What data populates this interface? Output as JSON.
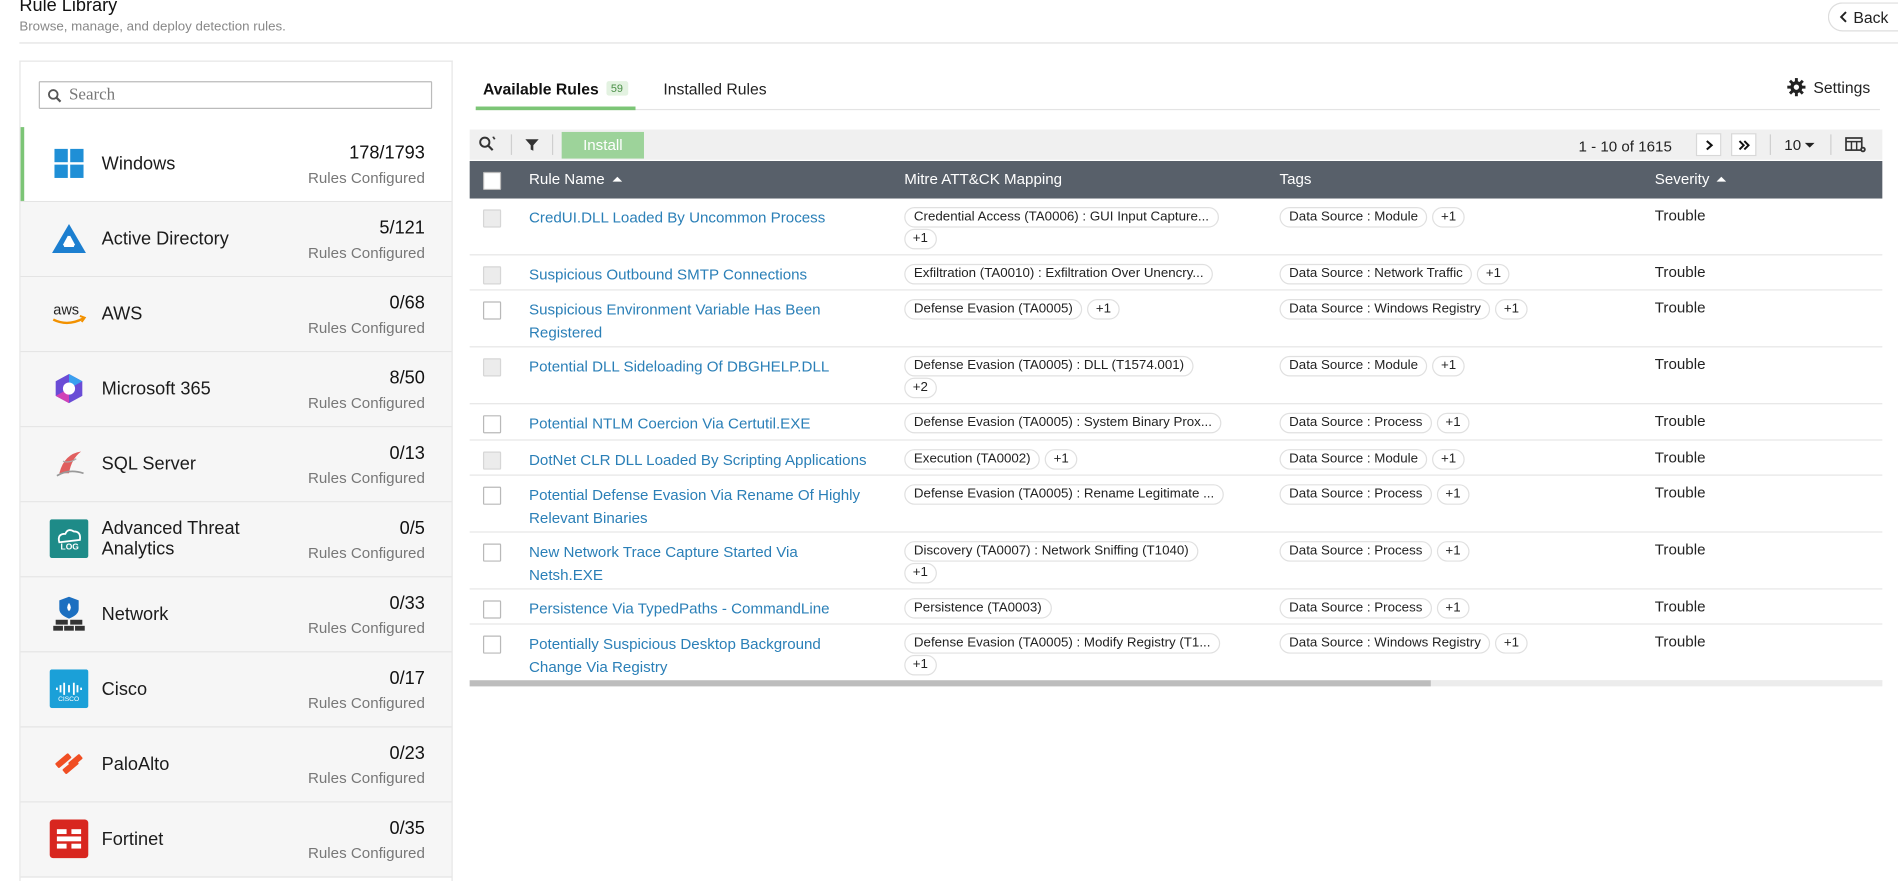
{
  "header": {
    "title": "Rule Library",
    "subtitle": "Browse, manage, and deploy detection rules.",
    "back_label": "Back"
  },
  "sidebar": {
    "search_placeholder": "Search",
    "categories": [
      {
        "name": "Windows",
        "count": "178/1793",
        "sub": "Rules Configured",
        "icon": "windows-icon",
        "active": true
      },
      {
        "name": "Active Directory",
        "count": "5/121",
        "sub": "Rules Configured",
        "icon": "active-directory-icon"
      },
      {
        "name": "AWS",
        "count": "0/68",
        "sub": "Rules Configured",
        "icon": "aws-icon"
      },
      {
        "name": "Microsoft 365",
        "count": "8/50",
        "sub": "Rules Configured",
        "icon": "microsoft-365-icon"
      },
      {
        "name": "SQL Server",
        "count": "0/13",
        "sub": "Rules Configured",
        "icon": "sql-server-icon"
      },
      {
        "name": "Advanced Threat Analytics",
        "count": "0/5",
        "sub": "Rules Configured",
        "icon": "ata-log-icon"
      },
      {
        "name": "Network",
        "count": "0/33",
        "sub": "Rules Configured",
        "icon": "network-firewall-icon"
      },
      {
        "name": "Cisco",
        "count": "0/17",
        "sub": "Rules Configured",
        "icon": "cisco-icon"
      },
      {
        "name": "PaloAlto",
        "count": "0/23",
        "sub": "Rules Configured",
        "icon": "paloalto-icon"
      },
      {
        "name": "Fortinet",
        "count": "0/35",
        "sub": "Rules Configured",
        "icon": "fortinet-icon"
      }
    ]
  },
  "tabs": {
    "available_label": "Available Rules",
    "available_count": "59",
    "installed_label": "Installed Rules",
    "settings_label": "Settings"
  },
  "toolbar": {
    "install_label": "Install",
    "pager_text": "1 - 10 of 1615",
    "per_page": "10"
  },
  "table": {
    "headers": {
      "name": "Rule Name",
      "mitre": "Mitre ATT&CK Mapping",
      "tags": "Tags",
      "severity": "Severity"
    },
    "rows": [
      {
        "name_lines": [
          "CredUI.DLL Loaded By Uncommon Process"
        ],
        "mitre": [
          "Credential Access (TA0006) : GUI Input Capture..."
        ],
        "mitre_plus": "+1",
        "mitre_plus_newline": true,
        "tag": "Data Source : Module",
        "tag_plus": "+1",
        "severity": "Trouble",
        "disabled": true,
        "height": 46
      },
      {
        "name_lines": [
          "Suspicious Outbound SMTP Connections"
        ],
        "mitre": [
          "Exfiltration (TA0010) : Exfiltration Over Unencry..."
        ],
        "mitre_plus": "",
        "mitre_plus_newline": false,
        "tag": "Data Source : Network Traffic",
        "tag_plus": "+1",
        "severity": "Trouble",
        "disabled": true,
        "height": 28
      },
      {
        "name_lines": [
          "Suspicious Environment Variable Has Been",
          "Registered"
        ],
        "mitre": [
          "Defense Evasion (TA0005)"
        ],
        "mitre_plus": "+1",
        "mitre_plus_newline": false,
        "tag": "Data Source : Windows Registry",
        "tag_plus": "+1",
        "severity": "Trouble",
        "disabled": false,
        "height": 46
      },
      {
        "name_lines": [
          "Potential DLL Sideloading Of DBGHELP.DLL"
        ],
        "mitre": [
          "Defense Evasion (TA0005) : DLL (T1574.001)"
        ],
        "mitre_plus": "+2",
        "mitre_plus_newline": true,
        "tag": "Data Source : Module",
        "tag_plus": "+1",
        "severity": "Trouble",
        "disabled": true,
        "height": 46
      },
      {
        "name_lines": [
          "Potential NTLM Coercion Via Certutil.EXE"
        ],
        "mitre": [
          "Defense Evasion (TA0005) : System Binary Prox..."
        ],
        "mitre_plus": "",
        "mitre_plus_newline": false,
        "tag": "Data Source : Process",
        "tag_plus": "+1",
        "severity": "Trouble",
        "disabled": false,
        "height": 29
      },
      {
        "name_lines": [
          "DotNet CLR DLL Loaded By Scripting Applications"
        ],
        "mitre": [
          "Execution (TA0002)"
        ],
        "mitre_plus": "+1",
        "mitre_plus_newline": false,
        "tag": "Data Source : Module",
        "tag_plus": "+1",
        "severity": "Trouble",
        "disabled": true,
        "height": 28
      },
      {
        "name_lines": [
          "Potential Defense Evasion Via Rename Of Highly",
          "Relevant Binaries"
        ],
        "mitre": [
          "Defense Evasion (TA0005) : Rename Legitimate ..."
        ],
        "mitre_plus": "",
        "mitre_plus_newline": false,
        "tag": "Data Source : Process",
        "tag_plus": "+1",
        "severity": "Trouble",
        "disabled": false,
        "height": 46
      },
      {
        "name_lines": [
          "New Network Trace Capture Started Via",
          "Netsh.EXE"
        ],
        "mitre": [
          "Discovery (TA0007) : Network Sniffing (T1040)"
        ],
        "mitre_plus": "+1",
        "mitre_plus_newline": true,
        "tag": "Data Source : Process",
        "tag_plus": "+1",
        "severity": "Trouble",
        "disabled": false,
        "height": 46
      },
      {
        "name_lines": [
          "Persistence Via TypedPaths - CommandLine"
        ],
        "mitre": [
          "Persistence (TA0003)"
        ],
        "mitre_plus": "",
        "mitre_plus_newline": false,
        "tag": "Data Source : Process",
        "tag_plus": "+1",
        "severity": "Trouble",
        "disabled": false,
        "height": 28
      },
      {
        "name_lines": [
          "Potentially Suspicious Desktop Background",
          "Change Via Registry"
        ],
        "mitre": [
          "Defense Evasion (TA0005) : Modify Registry (T1..."
        ],
        "mitre_plus": "+1",
        "mitre_plus_newline": true,
        "tag": "Data Source : Windows Registry",
        "tag_plus": "+1",
        "severity": "Trouble",
        "disabled": false,
        "height": 46
      }
    ]
  },
  "colors": {
    "accent": "#7cc576",
    "link": "#2a7fb7",
    "table_header": "#58606a",
    "install": "#9dd39a"
  }
}
